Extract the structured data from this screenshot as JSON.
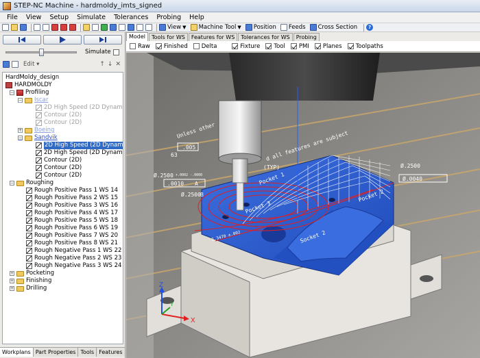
{
  "window": {
    "title": "STEP-NC Machine - hardmoldy_imts_signed"
  },
  "menu": [
    "File",
    "View",
    "Setup",
    "Simulate",
    "Tolerances",
    "Probing",
    "Help"
  ],
  "toolbar": {
    "view_label": "View",
    "machine_tool_label": "Machine Tool",
    "position_label": "Position",
    "feeds_label": "Feeds",
    "cross_section_label": "Cross Section",
    "help_label": "?"
  },
  "simulation": {
    "simulate_label": "Simulate",
    "simulate_checked": false,
    "slider_fraction": 0.5
  },
  "tree_toolbar": {
    "edit_label": "Edit"
  },
  "tree": {
    "rows": [
      {
        "label": "HardMoldy_design"
      },
      {
        "label": "HARDMOLDY"
      },
      {
        "label": "Profiling"
      },
      {
        "label": "Iscar"
      },
      {
        "label": "2D High Speed (2D Dynamic Core mill"
      },
      {
        "label": "Contour (2D)"
      },
      {
        "label": "Contour (2D)"
      },
      {
        "label": "Boeing"
      },
      {
        "label": "Sandvik"
      },
      {
        "label": "2D High Speed (2D Dynamic Core mill"
      },
      {
        "label": "2D High Speed (2D Dynamic Core mill"
      },
      {
        "label": "Contour (2D)"
      },
      {
        "label": "Contour (2D)"
      },
      {
        "label": "Contour (2D)"
      },
      {
        "label": "Roughing"
      },
      {
        "label": "Rough Positive Pass 1 WS 14"
      },
      {
        "label": "Rough Positive Pass 2 WS 15"
      },
      {
        "label": "Rough Positive Pass 3 WS 16"
      },
      {
        "label": "Rough Positive Pass 4 WS 17"
      },
      {
        "label": "Rough Positive Pass 5 WS 18"
      },
      {
        "label": "Rough Positive Pass 6 WS 19"
      },
      {
        "label": "Rough Positive Pass 7 WS 20"
      },
      {
        "label": "Rough Positive Pass 8 WS 21"
      },
      {
        "label": "Rough Negative Pass 1 WS 22"
      },
      {
        "label": "Rough Negative Pass 2 WS 23"
      },
      {
        "label": "Rough Negative Pass 3 WS 24"
      },
      {
        "label": "Pocketing"
      },
      {
        "label": "Finishing"
      },
      {
        "label": "Drilling"
      }
    ]
  },
  "left_tabs": [
    "Workplans",
    "Part Properties",
    "Tools",
    "Features"
  ],
  "view_tabs": [
    "Model",
    "Tools for WS",
    "Features for WS",
    "Tolerances for WS",
    "Probing"
  ],
  "filters": [
    {
      "label": "Raw",
      "checked": false
    },
    {
      "label": "Finished",
      "checked": true
    },
    {
      "label": "Delta",
      "checked": false
    },
    {
      "label": "Fixture",
      "checked": true
    },
    {
      "label": "Tool",
      "checked": true
    },
    {
      "label": "PMI",
      "checked": true
    },
    {
      "label": "Planes",
      "checked": true
    },
    {
      "label": "Toolpaths",
      "checked": true
    }
  ],
  "viewport": {
    "annotations": {
      "unless": "Unless other",
      "all_features": "d all features are subject",
      "d1": ".005",
      "d2": "63",
      "d3": "Ø.2500",
      "d3_tol": "+.0002 -.0000",
      "d4": "Ø.2500",
      "d5": "Ø.0040",
      "d6": "(TYP)",
      "d7": ".0010",
      "d8": "A",
      "d9": "Ø.2500",
      "d10": "B",
      "pocket1": "Pocket 1",
      "pocket2": "Pocket 2",
      "pocket3": "Pocket 3",
      "socket": "Socket 2",
      "dim_left": "2.3470 ±.002"
    },
    "axes": {
      "x": "X",
      "y": "Y",
      "z": "Z"
    },
    "colors": {
      "workpiece": "#2f5fd0",
      "fixture": "#ece9e4",
      "toolpath_red": "#e02020",
      "toolpath_white": "#ffffff",
      "machine": "#3a3a3a"
    }
  }
}
